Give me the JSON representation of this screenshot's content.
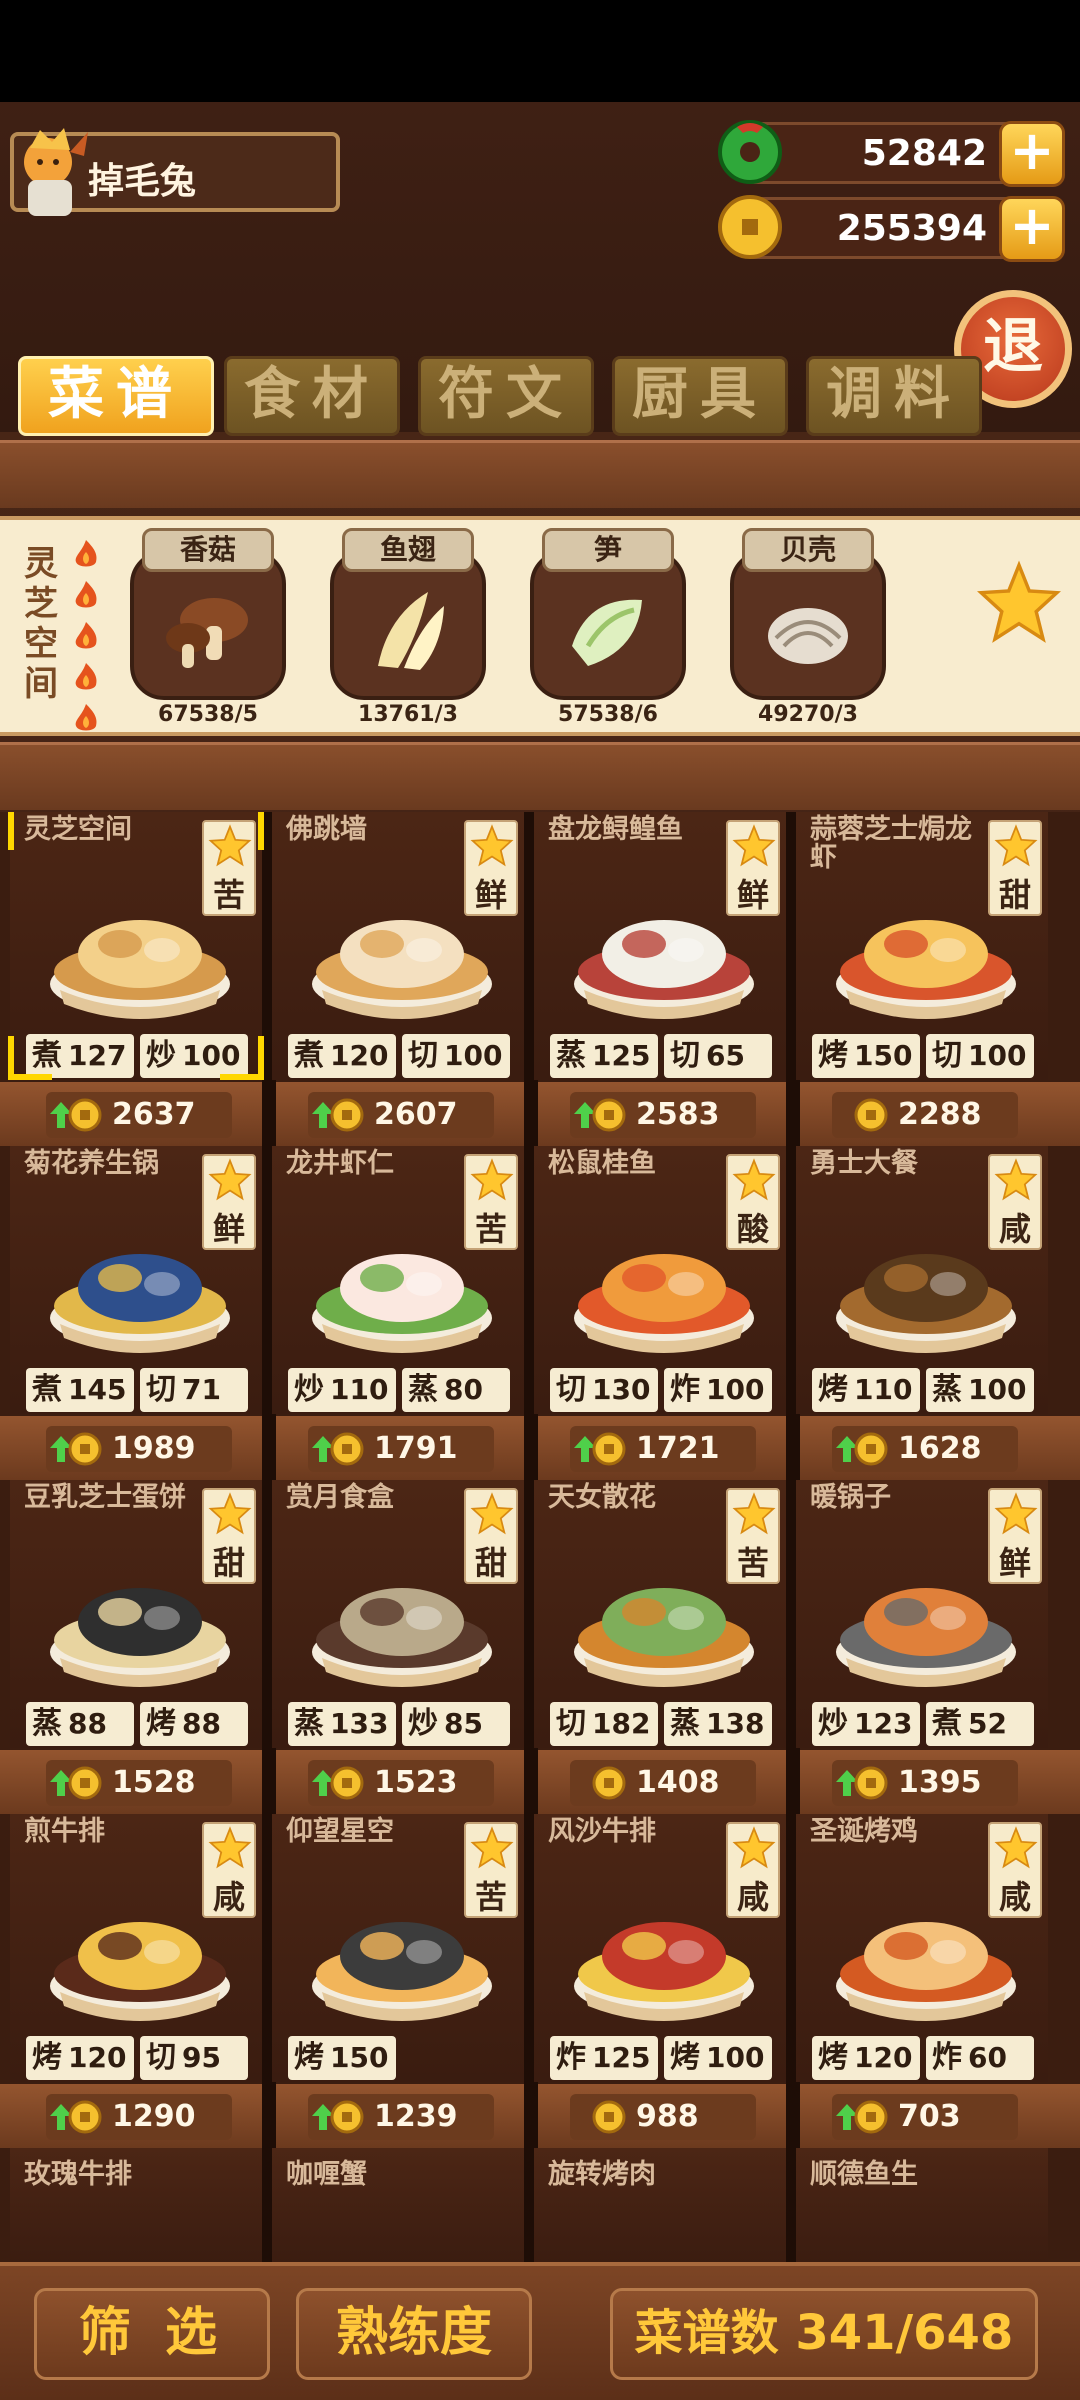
{
  "player": {
    "name": "掉毛兔"
  },
  "currency": {
    "jade": "52842",
    "coins": "255394",
    "plus": "+"
  },
  "exit_label": "退",
  "tabs": [
    "菜谱",
    "食材",
    "符文",
    "厨具",
    "调料"
  ],
  "recipe_detail": {
    "title": "灵芝空间",
    "ingredients": [
      {
        "name": "香菇",
        "count": "67538/5",
        "icon": "mushroom-icon"
      },
      {
        "name": "鱼翅",
        "count": "13761/3",
        "icon": "fish-fin-icon"
      },
      {
        "name": "笋",
        "count": "57538/6",
        "icon": "bamboo-shoot-icon"
      },
      {
        "name": "贝壳",
        "count": "49270/3",
        "icon": "shell-icon"
      }
    ]
  },
  "dishes": [
    {
      "name": "灵芝空间",
      "flavor": "苦",
      "skills": [
        [
          "煮",
          "127"
        ],
        [
          "炒",
          "100"
        ]
      ],
      "price": "2637",
      "up": true
    },
    {
      "name": "佛跳墙",
      "flavor": "鲜",
      "skills": [
        [
          "煮",
          "120"
        ],
        [
          "切",
          "100"
        ]
      ],
      "price": "2607",
      "up": true
    },
    {
      "name": "盘龙鲟鳇鱼",
      "flavor": "鲜",
      "skills": [
        [
          "蒸",
          "125"
        ],
        [
          "切",
          "65"
        ]
      ],
      "price": "2583",
      "up": true
    },
    {
      "name": "蒜蓉芝士焗龙虾",
      "flavor": "甜",
      "skills": [
        [
          "烤",
          "150"
        ],
        [
          "切",
          "100"
        ]
      ],
      "price": "2288",
      "up": false
    },
    {
      "name": "菊花养生锅",
      "flavor": "鲜",
      "skills": [
        [
          "煮",
          "145"
        ],
        [
          "切",
          "71"
        ]
      ],
      "price": "1989",
      "up": true
    },
    {
      "name": "龙井虾仁",
      "flavor": "苦",
      "skills": [
        [
          "炒",
          "110"
        ],
        [
          "蒸",
          "80"
        ]
      ],
      "price": "1791",
      "up": true
    },
    {
      "name": "松鼠桂鱼",
      "flavor": "酸",
      "skills": [
        [
          "切",
          "130"
        ],
        [
          "炸",
          "100"
        ]
      ],
      "price": "1721",
      "up": true
    },
    {
      "name": "勇士大餐",
      "flavor": "咸",
      "skills": [
        [
          "烤",
          "110"
        ],
        [
          "蒸",
          "100"
        ]
      ],
      "price": "1628",
      "up": true
    },
    {
      "name": "豆乳芝士蛋饼",
      "flavor": "甜",
      "skills": [
        [
          "蒸",
          "88"
        ],
        [
          "烤",
          "88"
        ]
      ],
      "price": "1528",
      "up": true
    },
    {
      "name": "赏月食盒",
      "flavor": "甜",
      "skills": [
        [
          "蒸",
          "133"
        ],
        [
          "炒",
          "85"
        ]
      ],
      "price": "1523",
      "up": true
    },
    {
      "name": "天女散花",
      "flavor": "苦",
      "skills": [
        [
          "切",
          "182"
        ],
        [
          "蒸",
          "138"
        ]
      ],
      "price": "1408",
      "up": false
    },
    {
      "name": "暖锅子",
      "flavor": "鲜",
      "skills": [
        [
          "炒",
          "123"
        ],
        [
          "煮",
          "52"
        ]
      ],
      "price": "1395",
      "up": true
    },
    {
      "name": "煎牛排",
      "flavor": "咸",
      "skills": [
        [
          "烤",
          "120"
        ],
        [
          "切",
          "95"
        ]
      ],
      "price": "1290",
      "up": true
    },
    {
      "name": "仰望星空",
      "flavor": "苦",
      "skills": [
        [
          "烤",
          "150"
        ]
      ],
      "price": "1239",
      "up": true
    },
    {
      "name": "风沙牛排",
      "flavor": "咸",
      "skills": [
        [
          "炸",
          "125"
        ],
        [
          "烤",
          "100"
        ]
      ],
      "price": "988",
      "up": false
    },
    {
      "name": "圣诞烤鸡",
      "flavor": "咸",
      "skills": [
        [
          "烤",
          "120"
        ],
        [
          "炸",
          "60"
        ]
      ],
      "price": "703",
      "up": true
    }
  ],
  "partial_dishes": [
    "玫瑰牛排",
    "咖喱蟹",
    "旋转烤肉",
    "顺德鱼生"
  ],
  "bottom": {
    "filter": "筛 选",
    "mastery": "熟练度",
    "recipe_count": "菜谱数 341/648"
  },
  "colors": {
    "accent_gold": "#ffc83a",
    "wood_dark": "#3b1d10",
    "tab_active": "#f0a21e"
  }
}
